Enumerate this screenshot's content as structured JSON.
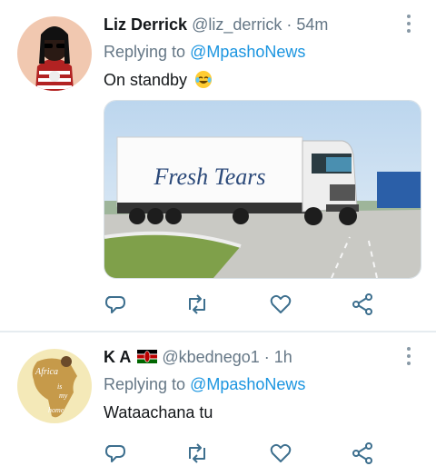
{
  "tweets": [
    {
      "name": "Liz Derrick",
      "handle": "@liz_derrick",
      "separator": "·",
      "time": "54m",
      "replying_prefix": "Replying to ",
      "replying_to": "@MpashoNews",
      "text": "On standby",
      "emoji": "face-with-tears-of-joy",
      "media": {
        "truck_text": "Fresh Tears"
      }
    },
    {
      "name": "K A",
      "name_flag": "kenya-flag",
      "handle": "@kbednego1",
      "separator": "·",
      "time": "1h",
      "replying_prefix": "Replying to ",
      "replying_to": "@MpashoNews",
      "text": "Wataachana tu",
      "avatar_words": [
        "Africa",
        "is",
        "my",
        "home"
      ]
    }
  ],
  "actions": [
    "reply-icon",
    "retweet-icon",
    "like-icon",
    "share-icon"
  ],
  "colors": {
    "link": "#1b95e0",
    "secondary": "#657786",
    "icon": "#3d6f8e"
  }
}
